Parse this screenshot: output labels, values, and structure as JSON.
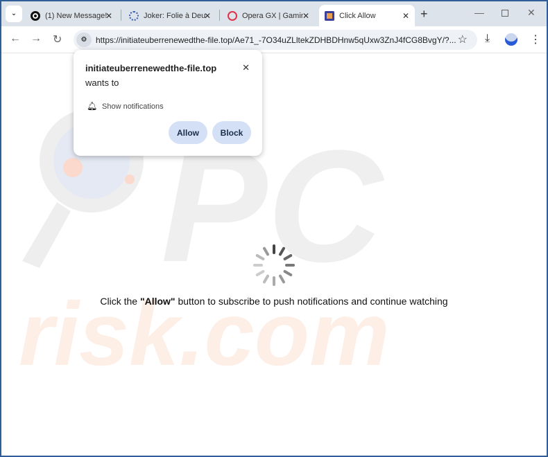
{
  "tabs": [
    {
      "title": "(1) New Message!",
      "icon": "message-icon"
    },
    {
      "title": "Joker: Folie à Deu",
      "icon": "loading-icon"
    },
    {
      "title": "Opera GX | Gamin",
      "icon": "opera-icon"
    },
    {
      "title": "Click Allow",
      "icon": "bell-icon",
      "active": true
    }
  ],
  "address_bar": {
    "url": "https://initiateuberrenewedthe-file.top/Ae71_-7O34uZLltekZDHBDHnw5qUxw3ZnJ4fCG8BvgY/?..."
  },
  "permission_popup": {
    "site": "initiateuberrenewedthe-file.top",
    "wants_to": "wants to",
    "permission": "Show notifications",
    "allow_label": "Allow",
    "block_label": "Block"
  },
  "page": {
    "message_before": "Click the ",
    "message_bold": "\"Allow\"",
    "message_after": " button to subscribe to push notifications and continue watching",
    "watermark": "PC risk.com"
  },
  "colors": {
    "frame": "#2f5d97",
    "button": "#d3e0f6"
  }
}
